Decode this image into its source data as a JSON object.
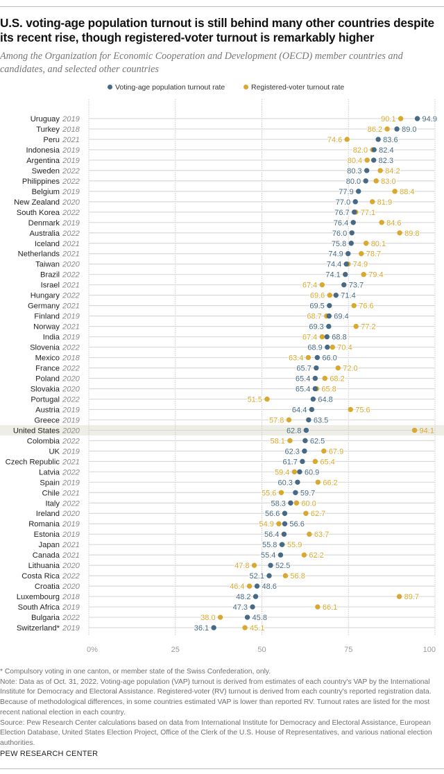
{
  "header": {
    "title": "U.S. voting-age population turnout is still behind many other countries despite its recent rise, though registered-voter turnout is remarkably higher",
    "subtitle": "Among the Organization for Economic Cooperation and Development (OECD) member countries and candidates, and selected other countries"
  },
  "colors": {
    "vap": "#466a86",
    "rv": "#d9a82e",
    "highlight_row": "#eeeee6",
    "gridline": "#d9d9d9"
  },
  "legend": {
    "vap_label": "Voting-age population turnout rate",
    "rv_label": "Registered-voter turnout rate"
  },
  "chart_data": {
    "type": "dot-plot",
    "title": "U.S. voting-age population turnout is still behind many other countries despite its recent rise, though registered-voter turnout is remarkably higher",
    "xlabel": "",
    "ylabel": "",
    "xlim": [
      0,
      100
    ],
    "x_ticks": [
      "0%",
      "25",
      "50",
      "75",
      "100"
    ],
    "x_tick_values": [
      0,
      25,
      50,
      75,
      100
    ],
    "grid": true,
    "legend_position": "top-center",
    "highlight": "United States",
    "series": [
      {
        "name": "Voting-age population turnout rate",
        "key": "vap"
      },
      {
        "name": "Registered-voter turnout rate",
        "key": "rv"
      }
    ],
    "rows": [
      {
        "country": "Uruguay",
        "year": "2019",
        "vap": 94.9,
        "rv": 90.1
      },
      {
        "country": "Turkey",
        "year": "2018",
        "vap": 89.0,
        "rv": 86.2
      },
      {
        "country": "Peru",
        "year": "2021",
        "vap": 83.6,
        "rv": 74.6
      },
      {
        "country": "Indonesia",
        "year": "2019",
        "vap": 82.4,
        "rv": 82.0
      },
      {
        "country": "Argentina",
        "year": "2019",
        "vap": 82.3,
        "rv": 80.4
      },
      {
        "country": "Sweden",
        "year": "2022",
        "vap": 80.3,
        "rv": 84.2
      },
      {
        "country": "Philippines",
        "year": "2022",
        "vap": 80.0,
        "rv": 83.0
      },
      {
        "country": "Belgium",
        "year": "2019",
        "vap": 77.9,
        "rv": 88.4
      },
      {
        "country": "New Zealand",
        "year": "2020",
        "vap": 77.0,
        "rv": 81.9
      },
      {
        "country": "South Korea",
        "year": "2022",
        "vap": 76.7,
        "rv": 77.1
      },
      {
        "country": "Denmark",
        "year": "2019",
        "vap": 76.4,
        "rv": 84.6
      },
      {
        "country": "Australia",
        "year": "2022",
        "vap": 76.0,
        "rv": 89.8
      },
      {
        "country": "Iceland",
        "year": "2021",
        "vap": 75.8,
        "rv": 80.1
      },
      {
        "country": "Netherlands",
        "year": "2021",
        "vap": 74.9,
        "rv": 78.7
      },
      {
        "country": "Taiwan",
        "year": "2020",
        "vap": 74.4,
        "rv": 74.9
      },
      {
        "country": "Brazil",
        "year": "2022",
        "vap": 74.1,
        "rv": 79.4
      },
      {
        "country": "Israel",
        "year": "2021",
        "vap": 73.7,
        "rv": 67.4
      },
      {
        "country": "Hungary",
        "year": "2022",
        "vap": 71.4,
        "rv": 69.6
      },
      {
        "country": "Germany",
        "year": "2021",
        "vap": 69.5,
        "rv": 76.6
      },
      {
        "country": "Finland",
        "year": "2019",
        "vap": 69.4,
        "rv": 68.7
      },
      {
        "country": "Norway",
        "year": "2021",
        "vap": 69.3,
        "rv": 77.2
      },
      {
        "country": "India",
        "year": "2019",
        "vap": 68.8,
        "rv": 67.4
      },
      {
        "country": "Slovenia",
        "year": "2022",
        "vap": 68.9,
        "rv": 70.4
      },
      {
        "country": "Mexico",
        "year": "2018",
        "vap": 66.0,
        "rv": 63.4
      },
      {
        "country": "France",
        "year": "2022",
        "vap": 65.7,
        "rv": 72.0
      },
      {
        "country": "Poland",
        "year": "2020",
        "vap": 65.4,
        "rv": 68.2
      },
      {
        "country": "Slovakia",
        "year": "2020",
        "vap": 65.4,
        "rv": 65.8
      },
      {
        "country": "Portugal",
        "year": "2022",
        "vap": 64.8,
        "rv": 51.5
      },
      {
        "country": "Austria",
        "year": "2019",
        "vap": 64.4,
        "rv": 75.6
      },
      {
        "country": "Greece",
        "year": "2019",
        "vap": 63.5,
        "rv": 57.8
      },
      {
        "country": "United States",
        "year": "2020",
        "vap": 62.8,
        "rv": 94.1
      },
      {
        "country": "Colombia",
        "year": "2022",
        "vap": 62.5,
        "rv": 58.1
      },
      {
        "country": "UK",
        "year": "2019",
        "vap": 62.3,
        "rv": 67.9
      },
      {
        "country": "Czech Republic",
        "year": "2021",
        "vap": 61.7,
        "rv": 65.4
      },
      {
        "country": "Latvia",
        "year": "2022",
        "vap": 60.9,
        "rv": 59.4
      },
      {
        "country": "Spain",
        "year": "2019",
        "vap": 60.3,
        "rv": 66.2
      },
      {
        "country": "Chile",
        "year": "2021",
        "vap": 59.7,
        "rv": 55.6
      },
      {
        "country": "Italy",
        "year": "2022",
        "vap": 58.3,
        "rv": 60.0
      },
      {
        "country": "Ireland",
        "year": "2020",
        "vap": 56.6,
        "rv": 62.7
      },
      {
        "country": "Romania",
        "year": "2019",
        "vap": 56.6,
        "rv": 54.9
      },
      {
        "country": "Estonia",
        "year": "2019",
        "vap": 56.4,
        "rv": 63.7
      },
      {
        "country": "Japan",
        "year": "2021",
        "vap": 55.8,
        "rv": 55.9
      },
      {
        "country": "Canada",
        "year": "2021",
        "vap": 55.4,
        "rv": 62.2
      },
      {
        "country": "Lithuania",
        "year": "2020",
        "vap": 52.5,
        "rv": 47.8
      },
      {
        "country": "Costa Rica",
        "year": "2022",
        "vap": 52.1,
        "rv": 56.8
      },
      {
        "country": "Croatia",
        "year": "2020",
        "vap": 48.6,
        "rv": 46.4
      },
      {
        "country": "Luxembourg",
        "year": "2018",
        "vap": 48.2,
        "rv": 89.7
      },
      {
        "country": "South Africa",
        "year": "2019",
        "vap": 47.3,
        "rv": 66.1
      },
      {
        "country": "Bulgaria",
        "year": "2022",
        "vap": 45.8,
        "rv": 38.0
      },
      {
        "country": "Switzerland*",
        "year": "2019",
        "vap": 36.1,
        "rv": 45.1
      }
    ]
  },
  "notes": {
    "footnote": "* Compulsory voting in one canton, or member state of the Swiss Confederation, only.",
    "note": "Note: Data as of Oct. 31, 2022. Voting-age population (VAP) turnout is derived from estimates of each country's VAP by the International Institute for Democracy and Electoral Assistance. Registered-voter (RV) turnout is derived from each country's reported registration data. Because of methodological differences, in some countries estimated VAP is lower than reported RV. Turnout rates are listed for the most recent national election in each country.",
    "source": "Source: Pew Research Center calculations based on data from International Institute for Democracy and Electoral Assistance, European Election Database, United States Election Project, Office of the Clerk of the U.S. House of Representatives, and various national election authorities."
  },
  "brand": "PEW RESEARCH CENTER"
}
